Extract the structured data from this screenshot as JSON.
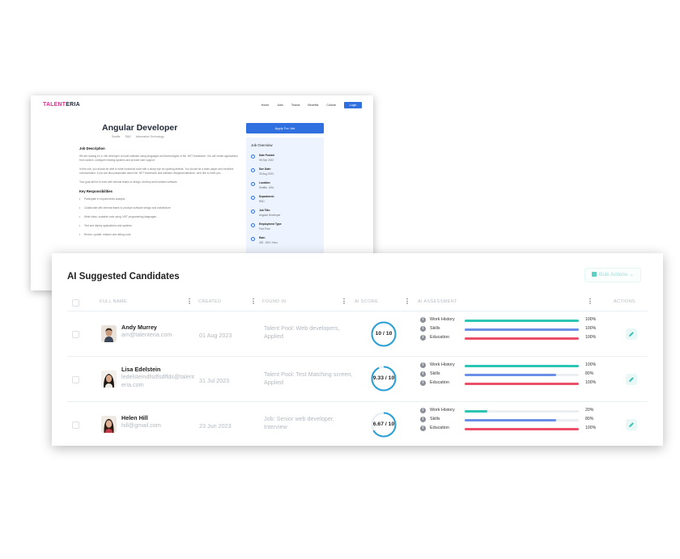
{
  "job_page": {
    "brand": {
      "part1": "TALENT",
      "part2": "ERIA"
    },
    "nav": [
      "Home",
      "Jobs",
      "Teams",
      "Benefits",
      "Culture"
    ],
    "login_label": "Login",
    "title": "Angular Developer",
    "meta": [
      "Seattle",
      "R&D",
      "Information Technology"
    ],
    "description_heading": "Job Description",
    "paragraphs": [
      "We are looking for a .Net developer to build software using languages and technologies of the .NET framework. You will create applications from scratch, configure existing systems and provide user support.",
      "In this role, you should be able to write functional code with a sharp eye for spotting defects. You should be a team player and excellent communicator. If you are also passionate about the .NET framework and software design/architecture, we'd like to meet you.",
      "Your goal will be to work with internal teams to design, develop and maintain software."
    ],
    "responsibilities_heading": "Key Responsibilities",
    "responsibilities": [
      "Participate in requirements analysis",
      "Collaborate with internal teams to produce software design and architecture",
      "Write clean, scalable code using .NET programming languages",
      "Test and deploy applications and systems",
      "Revise, update, refactor and debug code"
    ],
    "apply_label": "Apply For Job",
    "overview_title": "Job Overview",
    "overview": [
      {
        "icon": "clock-icon",
        "label": "Date Posted:",
        "value": "08 Sep 2022"
      },
      {
        "icon": "share-icon",
        "label": "Due Date:",
        "value": "30 Aug 2023"
      },
      {
        "icon": "location-pin-icon",
        "label": "Location:",
        "value": "Seattle, USA"
      },
      {
        "icon": "building-icon",
        "label": "Department:",
        "value": "R&D"
      },
      {
        "icon": "user-icon",
        "label": "Job Title:",
        "value": "Angular Developer"
      },
      {
        "icon": "check-circle-icon",
        "label": "Employment Type:",
        "value": "Part Time"
      },
      {
        "icon": "money-icon",
        "label": "Rate:",
        "value": "300 - 800 / Hour"
      }
    ]
  },
  "candidates": {
    "title": "AI Suggested Candidates",
    "bulk_actions_label": "Bulk Actions",
    "columns": {
      "full_name": "FULL NAME",
      "created": "CREATED",
      "found_in": "FOUND IN",
      "ai_score": "AI SCORE",
      "ai_assessment": "AI ASSESSMENT",
      "actions": "ACTIONS"
    },
    "assessment_labels": [
      "Work History",
      "Skills",
      "Education"
    ],
    "colors": {
      "work_history": "#2cc4b3",
      "skills": "#6a8fe6",
      "education": "#ec4f6a",
      "score_ring": "#2a9fd6"
    },
    "rows": [
      {
        "name": "Andy Murrey",
        "email": "am@talenteria.com",
        "created": "01 Aug 2023",
        "found_in": "Talent Pool: Web developers, Applied",
        "score_text": "10 / 10",
        "score_fraction": 1.0,
        "assessment": [
          {
            "label": "Work History",
            "value": 1.0,
            "pct": "100%"
          },
          {
            "label": "Skills",
            "value": 1.0,
            "pct": "100%"
          },
          {
            "label": "Education",
            "value": 1.0,
            "pct": "100%"
          }
        ]
      },
      {
        "name": "Lisa Edelstein",
        "email": "ledelsteindfsdfsdffds@talenteria.com",
        "created": "31 Jul 2023",
        "found_in": "Talent Pool: Test Matching screen, Applied",
        "score_text": "9.33 / 10",
        "score_fraction": 0.933,
        "assessment": [
          {
            "label": "Work History",
            "value": 1.0,
            "pct": "100%"
          },
          {
            "label": "Skills",
            "value": 0.8,
            "pct": "80%"
          },
          {
            "label": "Education",
            "value": 1.0,
            "pct": "100%"
          }
        ]
      },
      {
        "name": "Helen Hill",
        "email": "hill@gmail.com",
        "created": "23 Jun 2023",
        "found_in": "Job: Senior web developer, Interview",
        "score_text": "6.67 / 10",
        "score_fraction": 0.667,
        "assessment": [
          {
            "label": "Work History",
            "value": 0.2,
            "pct": "20%"
          },
          {
            "label": "Skills",
            "value": 0.8,
            "pct": "80%"
          },
          {
            "label": "Education",
            "value": 1.0,
            "pct": "100%"
          }
        ]
      }
    ]
  }
}
